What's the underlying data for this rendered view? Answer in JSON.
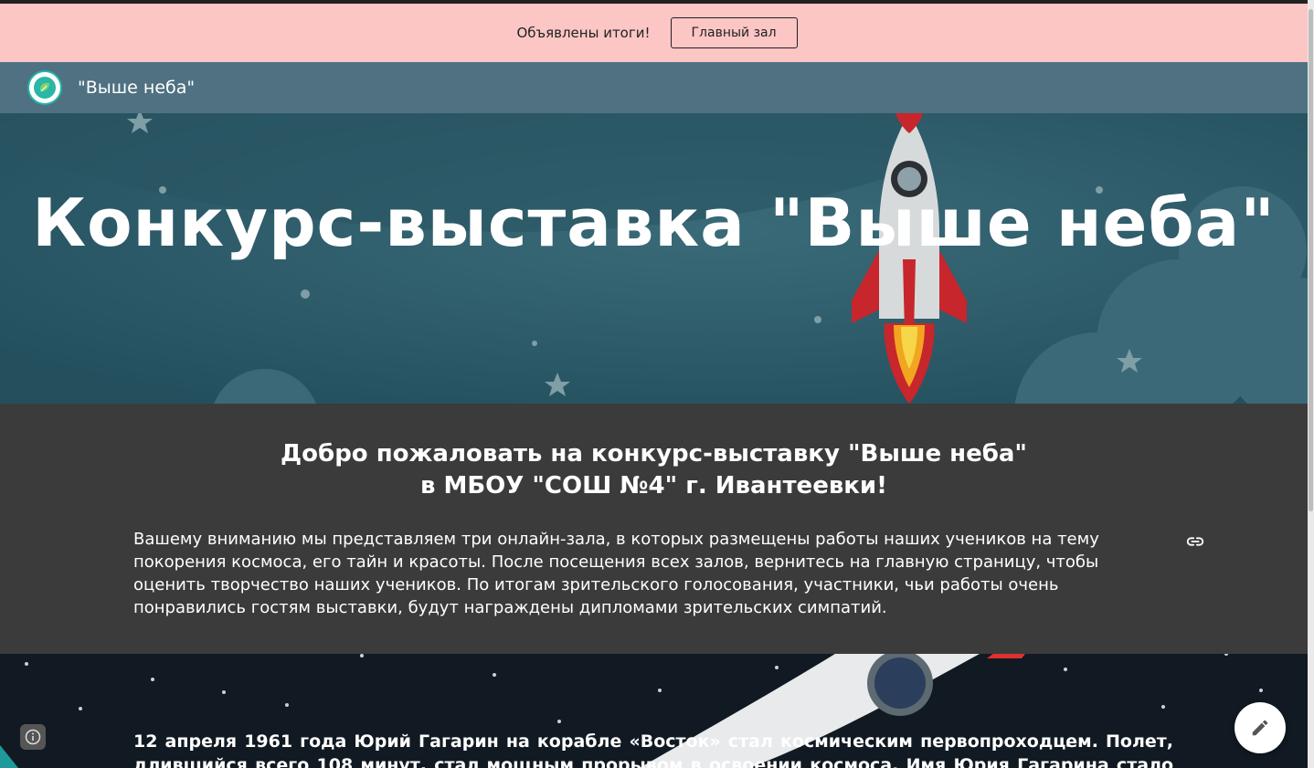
{
  "banner": {
    "text": "Объявлены итоги!",
    "button_label": "Главный зал"
  },
  "header": {
    "logo_icon": "school-logo-icon",
    "site_name": "\"Выше неба\""
  },
  "hero": {
    "title": "Конкурс-выставка \"Выше неба\""
  },
  "intro": {
    "heading_line1": "Добро пожаловать на конкурс-выставку \"Выше неба\"",
    "heading_line2": "в МБОУ \"СОШ №4\" г. Ивантеевки!",
    "text": "Вашему вниманию мы представляем три онлайн-зала, в которых размещены работы наших учеников на тему покорения космоса, его тайн и красоты.  После посещения всех залов, вернитесь на главную страницу, чтобы оценить творчество наших учеников. По итогам зрительского голосования, участники, чьи работы очень понравились гостям выставки, будут награждены дипломами зрительских симпатий.",
    "link_icon": "link-icon"
  },
  "article": {
    "text": "12 апреля 1961 года Юрий Гагарин на корабле «Восток» стал космическим первопроходцем. Полет, длившийся всего 108 минут, стал мощным прорывом в освоении космоса. Имя Юрия Гагарина стало широко"
  },
  "controls": {
    "info_icon": "info-icon",
    "edit_icon": "pencil-icon"
  },
  "colors": {
    "banner_bg": "#fbc6c4",
    "header_bg": "#4f7181",
    "hero_bg": "#2e5968",
    "intro_bg": "#3b3b3b"
  }
}
